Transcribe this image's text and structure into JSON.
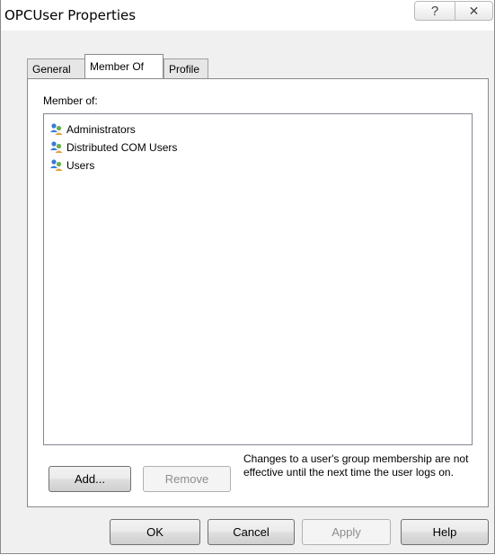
{
  "window": {
    "title": "OPCUser Properties"
  },
  "caption_buttons": {
    "help": "?",
    "close": "✕"
  },
  "tabs": [
    {
      "label": "General",
      "active": false
    },
    {
      "label": "Member Of",
      "active": true
    },
    {
      "label": "Profile",
      "active": false
    }
  ],
  "member_of": {
    "label": "Member of:",
    "groups": [
      {
        "name": "Administrators",
        "icon": "user-group-icon"
      },
      {
        "name": "Distributed COM Users",
        "icon": "user-group-icon"
      },
      {
        "name": "Users",
        "icon": "user-group-icon"
      }
    ]
  },
  "actions": {
    "add_label": "Add...",
    "remove_label": "Remove",
    "remove_enabled": false,
    "note": "Changes to a user's group membership are not effective until the next time the user logs on."
  },
  "footer": {
    "ok_label": "OK",
    "cancel_label": "Cancel",
    "apply_label": "Apply",
    "apply_enabled": false,
    "help_label": "Help"
  }
}
